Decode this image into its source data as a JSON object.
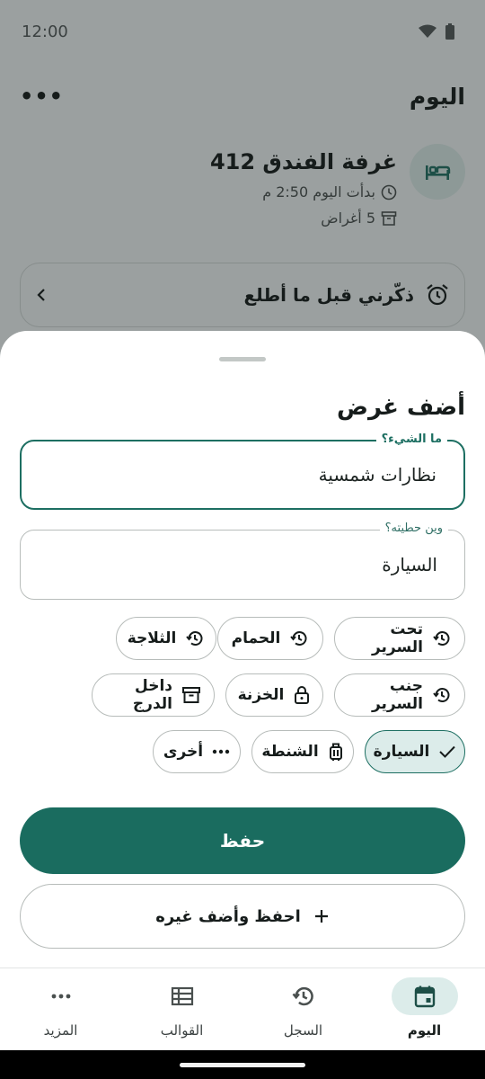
{
  "status_bar": {
    "time": "12:00"
  },
  "header": {
    "title": "اليوم",
    "more_label": "•••"
  },
  "session": {
    "title": "غرفة الفندق 412",
    "started": "بدأت اليوم 2:50 م",
    "items_count": "5 أغراض",
    "icon": "bed-icon"
  },
  "reminder": {
    "label": "ذكّرني قبل ما أطلع"
  },
  "sheet": {
    "title": "أضف غرض",
    "what_field": {
      "label": "ما الشيء؟",
      "value": "نظارات شمسية"
    },
    "where_field": {
      "label": "وين حطيته؟",
      "value": "السيارة"
    },
    "chips": [
      {
        "label": "تحت السرير",
        "icon": "history-icon",
        "selected": false
      },
      {
        "label": "الحمام",
        "icon": "history-icon",
        "selected": false
      },
      {
        "label": "الثلاجة",
        "icon": "history-icon",
        "selected": false
      },
      {
        "label": "جنب السرير",
        "icon": "history-icon",
        "selected": false
      },
      {
        "label": "الخزنة",
        "icon": "lock-icon",
        "selected": false
      },
      {
        "label": "داخل الدرج",
        "icon": "archive-icon",
        "selected": false
      },
      {
        "label": "السيارة",
        "icon": "check-icon",
        "selected": true
      },
      {
        "label": "الشنطة",
        "icon": "luggage-icon",
        "selected": false
      },
      {
        "label": "أخرى",
        "icon": "more-icon",
        "selected": false
      }
    ],
    "save_label": "حفظ",
    "save_add_label": "احفظ وأضف غيره"
  },
  "nav": [
    {
      "label": "اليوم",
      "icon": "calendar-icon",
      "active": true
    },
    {
      "label": "السجل",
      "icon": "history-icon",
      "active": false
    },
    {
      "label": "القوالب",
      "icon": "template-icon",
      "active": false
    },
    {
      "label": "المزيد",
      "icon": "more-icon",
      "active": false
    }
  ],
  "colors": {
    "accent": "#1a6c5f",
    "accent_container": "#dcecea",
    "scrim_background": "#9ba0a0"
  }
}
